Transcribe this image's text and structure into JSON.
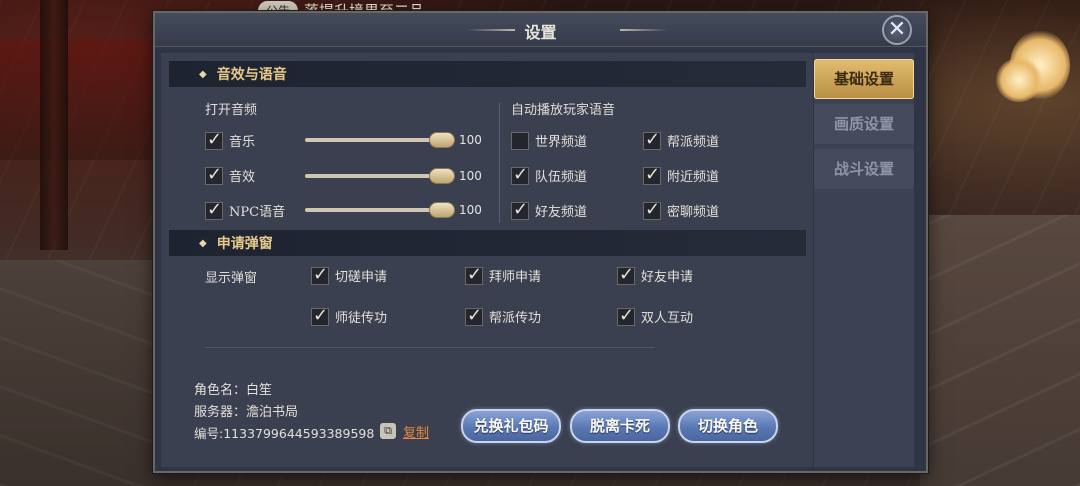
{
  "announcement": {
    "tag": "公告",
    "text": "落提升境界至二品"
  },
  "window": {
    "title": "设置",
    "close_icon": "close-icon"
  },
  "tabs": [
    {
      "label": "基础设置",
      "active": true
    },
    {
      "label": "画质设置",
      "active": false
    },
    {
      "label": "战斗设置",
      "active": false
    }
  ],
  "audio_section": {
    "header": "音效与语音",
    "open_audio_title": "打开音频",
    "channels": [
      {
        "label": "音乐",
        "checked": true,
        "value": 100
      },
      {
        "label": "音效",
        "checked": true,
        "value": 100
      },
      {
        "label": "NPC语音",
        "checked": true,
        "value": 100
      }
    ],
    "autoplay_title": "自动播放玩家语音",
    "voice_channels": [
      {
        "label": "世界频道",
        "checked": false
      },
      {
        "label": "帮派频道",
        "checked": true
      },
      {
        "label": "队伍频道",
        "checked": true
      },
      {
        "label": "附近频道",
        "checked": true
      },
      {
        "label": "好友频道",
        "checked": true
      },
      {
        "label": "密聊频道",
        "checked": true
      }
    ]
  },
  "popup_section": {
    "header": "申请弹窗",
    "title": "显示弹窗",
    "options": [
      {
        "label": "切磋申请",
        "checked": true
      },
      {
        "label": "拜师申请",
        "checked": true
      },
      {
        "label": "好友申请",
        "checked": true
      },
      {
        "label": "师徒传功",
        "checked": true
      },
      {
        "label": "帮派传功",
        "checked": true
      },
      {
        "label": "双人互动",
        "checked": true
      }
    ]
  },
  "account": {
    "role_name": "角色名：白笙",
    "server": "服务器：澹泊书局",
    "id": "编号:1133799644593389598",
    "copy_label": "复制"
  },
  "actions": {
    "redeem": "兑换礼包码",
    "unstuck": "脱离卡死",
    "switch_role": "切换角色"
  },
  "colors": {
    "accent_gold": "#e6c98a",
    "active_tab": "#d7b064",
    "button_blue": "#5a78b4",
    "copy_link": "#e8883a"
  }
}
